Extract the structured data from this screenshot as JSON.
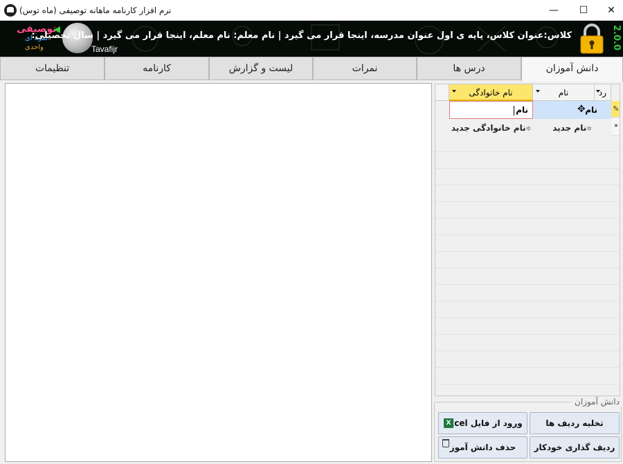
{
  "window": {
    "title": "نرم افزار کارنامه ماهانه توصیفی (ماه توس)",
    "controls": {
      "minimize": "—",
      "maximize": "☐",
      "close": "✕"
    }
  },
  "banner": {
    "brand_main": "توصیفی",
    "brand_line2": "نمره ای",
    "brand_line3": "واحدی",
    "watermark": "Tavafijr",
    "info_text": "کلاس:عنوان کلاس، پایه ی اول عنوان مدرسه، اینجا قرار می گیرد | نام معلم: نام معلم، اینجا قرار می گیرد | سال تحصیلی:",
    "version": "2.0.0",
    "colors": {
      "brand_pink": "#ff4d8d",
      "brand_blue": "#4fb0ff",
      "brand_orange": "#e8a23a",
      "version_green": "#39c23e"
    }
  },
  "tabs": [
    {
      "label": "دانش آموزان",
      "active": true
    },
    {
      "label": "درس ها",
      "active": false
    },
    {
      "label": "نمرات",
      "active": false
    },
    {
      "label": "لیست و گزارش",
      "active": false
    },
    {
      "label": "کارنامه",
      "active": false
    },
    {
      "label": "تنظیمات",
      "active": false
    }
  ],
  "grid": {
    "columns": [
      {
        "label": "رد",
        "filter": true
      },
      {
        "label": "نام",
        "filter": true
      },
      {
        "label": "نام خانوادگی",
        "filter": true,
        "highlighted": true
      }
    ],
    "editing_row": {
      "indicator": "✎",
      "name": "نام",
      "family": "نام"
    },
    "new_row": {
      "indicator": "*",
      "name": "نام جدید",
      "family": "نام خانوادگی جدید",
      "asterisk": "✲"
    }
  },
  "students_group": {
    "legend": "دانش آموزان",
    "buttons": {
      "clear_rows": "تخلیه ردیف ها",
      "import_excel": "ورود از فایل Excel",
      "auto_numbering": "ردیف گذاری خودکار",
      "delete_student": "حذف دانش آموز"
    },
    "icons": {
      "excel": "excel-icon",
      "delete": "trash-icon"
    }
  }
}
